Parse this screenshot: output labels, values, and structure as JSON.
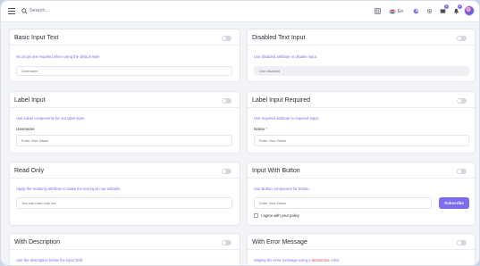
{
  "topbar": {
    "search_placeholder": "Search...",
    "language": "En",
    "notifications_count": "2",
    "messages_count": "3"
  },
  "cards": {
    "basic": {
      "title": "Basic Input Text",
      "desc": "No props are required when using the default style.",
      "placeholder": "Username"
    },
    "disabled": {
      "title": "Disabled Text Input",
      "desc_prefix": "Use ",
      "desc_hl": "disabled",
      "desc_suffix": " attribute to disable input.",
      "placeholder": "Use disabled"
    },
    "label_input": {
      "title": "Label Input",
      "desc_prefix": "Use ",
      "desc_hl": "Label",
      "desc_suffix": " components for our label style.",
      "label": "Username",
      "placeholder": "Enter Your Name"
    },
    "label_required": {
      "title": "Label Input Required",
      "desc_prefix": "Use ",
      "desc_hl": "required",
      "desc_suffix": " attribute to required input.",
      "label": "Name",
      "required_mark": "*",
      "placeholder": "Enter Your Name"
    },
    "read_only": {
      "title": "Read Only",
      "desc_prefix": "Apply the ",
      "desc_hl": "readonly",
      "desc_suffix": " attribute to make the text input non-editable.",
      "placeholder": "You can read only me"
    },
    "with_button": {
      "title": "Input With Button",
      "desc_prefix": "Use ",
      "desc_hl": "Button",
      "desc_suffix": " component for button.",
      "placeholder": "Enter Your Name",
      "button_label": "Subscribe",
      "checkbox_label": "I agree with your policy"
    },
    "with_description": {
      "title": "With Description",
      "desc": "Use the description below the input field."
    },
    "with_error": {
      "title": "With Error Message",
      "desc_prefix": "Display the error message using a ",
      "desc_err": "destructive",
      "desc_suffix": " color."
    }
  },
  "colors": {
    "accent": "#7c6df0",
    "error": "#e0485a",
    "background": "#f3f4f8"
  }
}
